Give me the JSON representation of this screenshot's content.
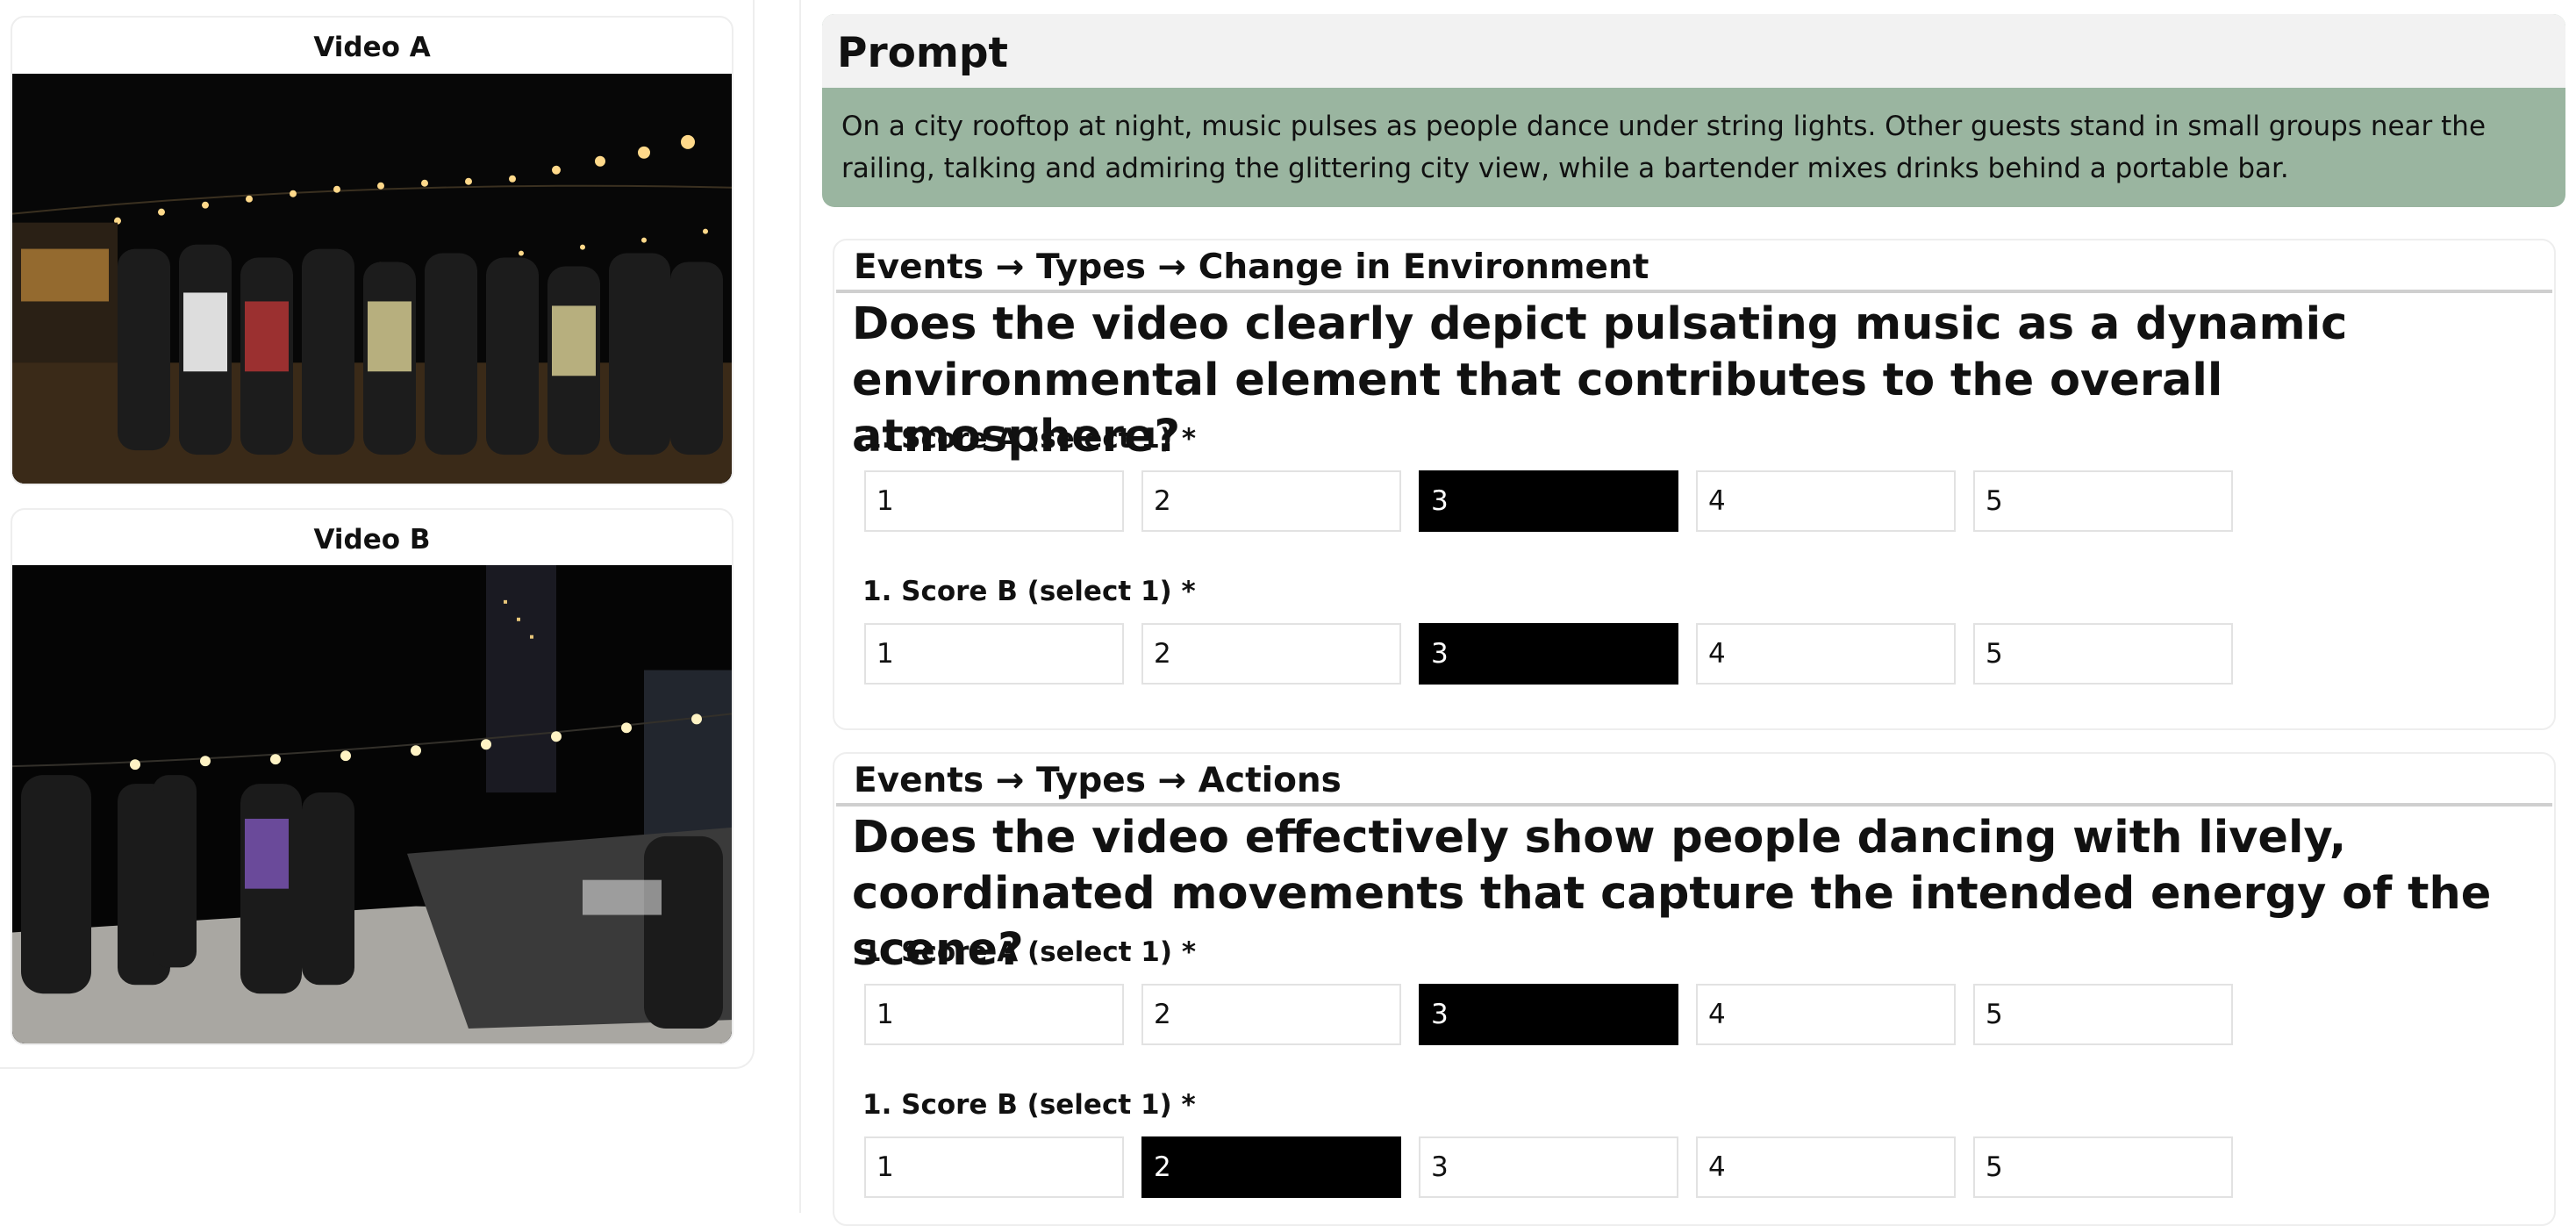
{
  "videos": {
    "a": {
      "title": "Video A"
    },
    "b": {
      "title": "Video B"
    }
  },
  "prompt": {
    "heading": "Prompt",
    "text": "On a city rooftop at night, music pulses as people dance under string lights. Other guests stand in small groups near the railing, talking and admiring the glittering city view, while a bartender mixes drinks behind a portable bar."
  },
  "questions": [
    {
      "crumb": "Events → Types → Change in Environment",
      "text": "Does the video clearly depict pulsating music as a dynamic environmental element that contributes to the overall atmosphere?",
      "score_a_label": "1. Score A (select 1) *",
      "score_b_label": "1. Score B (select 1) *",
      "options": [
        "1",
        "2",
        "3",
        "4",
        "5"
      ],
      "selected_a": "3",
      "selected_b": "3"
    },
    {
      "crumb": "Events → Types → Actions",
      "text": "Does the video effectively show people dancing with lively, coordinated movements that capture the intended energy of the scene?",
      "score_a_label": "1. Score A (select 1) *",
      "score_b_label": "1. Score B (select 1) *",
      "options": [
        "1",
        "2",
        "3",
        "4",
        "5"
      ],
      "selected_a": "3",
      "selected_b": "2"
    }
  ],
  "colors": {
    "selected_bg": "#000000",
    "prompt_bg": "#9ab5a0",
    "prompt_head_bg": "#f2f2f2"
  }
}
